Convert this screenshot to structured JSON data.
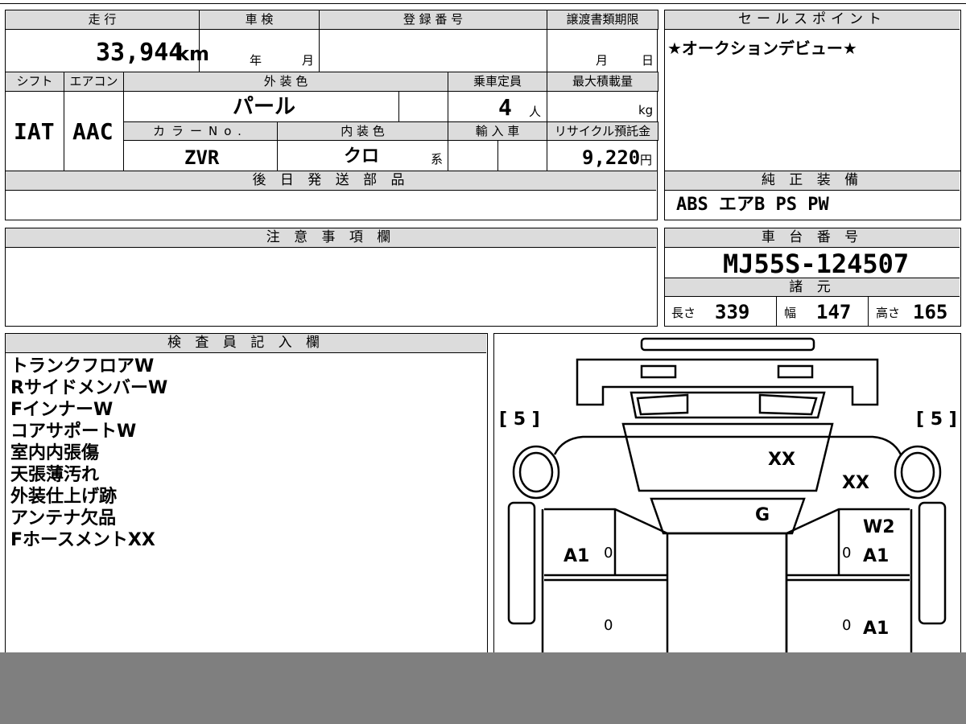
{
  "mileage": {
    "label": "走 行",
    "value": "33,944",
    "unit": "km"
  },
  "shaken": {
    "label": "車 検",
    "year": "年",
    "month": "月"
  },
  "registration": {
    "label": "登 録 番 号",
    "value": ""
  },
  "transfer_deadline": {
    "label": "譲渡書類期限",
    "month": "月",
    "day": "日"
  },
  "sales_point": {
    "label": "セールスポイント",
    "text": "★オークションデビュー★"
  },
  "shift": {
    "label": "シフト",
    "value": "IAT"
  },
  "aircon": {
    "label": "エアコン",
    "value": "AAC"
  },
  "exterior_color": {
    "label": "外 装 色",
    "value": "パール"
  },
  "capacity": {
    "label": "乗車定員",
    "value": "4",
    "unit": "人"
  },
  "max_load": {
    "label": "最大積載量",
    "unit": "kg"
  },
  "color_no": {
    "label": "カラーNo.",
    "value": "ZVR"
  },
  "interior_color": {
    "label": "内 装 色",
    "value": "クロ",
    "suffix": "系"
  },
  "import": {
    "label": "輸 入 車"
  },
  "recycle": {
    "label": "リサイクル預託金",
    "value": "9,220",
    "unit": "円"
  },
  "later_parts": {
    "label": "後 日 発 送 部 品"
  },
  "equipment": {
    "label": "純 正 装 備",
    "value": "ABS エアB PS PW"
  },
  "caution": {
    "label": "注 意 事 項 欄"
  },
  "chassis_no": {
    "label": "車 台 番 号",
    "value": "MJ55S-124507"
  },
  "specs": {
    "label": "諸 元",
    "length_label": "長さ",
    "length": "339",
    "width_label": "幅",
    "width": "147",
    "height_label": "高さ",
    "height": "165"
  },
  "inspector": {
    "label": "検 査 員 記 入 欄",
    "notes": [
      "トランクフロアW",
      "RサイドメンバーW",
      "FインナーW",
      "コアサポートW",
      "室内内張傷",
      "天張薄汚れ",
      "外装仕上げ跡",
      "アンテナ欠品",
      "FホースメントXX"
    ]
  },
  "diagram": {
    "tire_left": "[ 5 ]",
    "tire_right": "[ 5 ]",
    "marks": {
      "hood_xx": "XX",
      "right_fender_xx": "XX",
      "windshield_g": "G",
      "right_door_w2": "W2",
      "left_front_door": "A1",
      "right_front_door": "A1",
      "right_rear_door": "A1",
      "zero_1": "0",
      "zero_2": "0",
      "zero_3": "0",
      "zero_4": "0"
    }
  }
}
